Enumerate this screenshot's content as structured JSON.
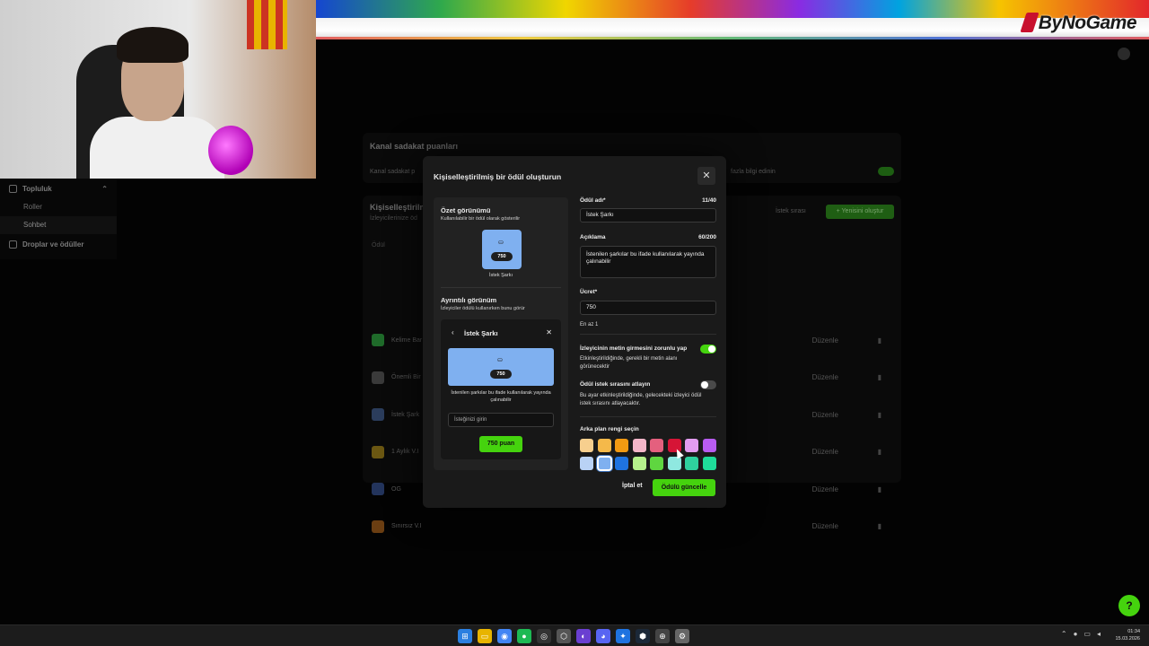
{
  "brand": {
    "logo_text": "ByNoGame"
  },
  "sidebar": {
    "group_label": "Topluluk",
    "items": [
      {
        "label": "Roller",
        "active": false
      },
      {
        "label": "Sohbet",
        "active": true
      }
    ],
    "group2_label": "Droplar ve ödüller"
  },
  "background": {
    "loyalty_title": "Kanal sadakat puanları",
    "loyalty_sub": "Kanal sadakat p",
    "loyalty_more": "fazla bilgi edinin",
    "custom_title": "Kişiselleştirilm",
    "custom_sub": "İzleyicilerinize öd",
    "queue_label": "İstek sırası",
    "new_button": "+ Yenisini oluştur",
    "col_reward": "Ödül",
    "edit_label": "Düzenle",
    "rows": [
      {
        "name": "Kelime Bar",
        "color": "#1f6b2a"
      },
      {
        "name": "Önemli Bir",
        "color": "#3a3a3a"
      },
      {
        "name": "İstek Şark",
        "color": "#2b3d5c"
      },
      {
        "name": "1 Aylık V.I",
        "color": "#6b5712"
      },
      {
        "name": "OG",
        "color": "#23345c"
      },
      {
        "name": "Sınırsız V.I",
        "color": "#6b3e12"
      }
    ]
  },
  "modal": {
    "title": "Kişiselleştirilmiş bir ödül oluşturun",
    "preview": {
      "summary_title": "Özet görünümü",
      "summary_sub": "Kullanılabilir bir ödül olarak gösterilir",
      "reward_cost": "750",
      "reward_name": "İstek Şarkı",
      "detail_title": "Ayrıntılı görünüm",
      "detail_sub": "İzleyiciler ödülü kullanırken bunu görür",
      "detail_header": "İstek Şarkı",
      "detail_desc": "İstenilen şarkılar bu ifade kullanılarak yayında çalınabilir",
      "input_placeholder": "İsteğinizi girin",
      "redeem_button": "750 puan"
    },
    "form": {
      "name_label": "Ödül adı*",
      "name_count": "11/40",
      "name_value": "İstek Şarkı",
      "desc_label": "Açıklama",
      "desc_count": "60/200",
      "desc_value": "İstenilen şarkılar bu ifade kullanılarak yayında çalınabilir",
      "cost_label": "Ücret*",
      "cost_value": "750",
      "cost_hint": "En az 1",
      "require_text_label": "İzleyicinin metin girmesini zorunlu yap",
      "require_text_desc": "Etkinleştirildiğinde, gerekli bir metin alanı görünecektir",
      "require_text_on": true,
      "skip_queue_label": "Ödül istek sırasını atlayın",
      "skip_queue_desc": "Bu ayar etkinleştirildiğinde, gelecekteki izleyici ödül istek sırasını atlayacaktır.",
      "skip_queue_on": false,
      "color_label": "Arka plan rengi seçin",
      "colors": [
        "#f7cf8e",
        "#f5b94a",
        "#f29a12",
        "#f4b6c9",
        "#e4607e",
        "#d61436",
        "#e39cf0",
        "#b85cf0",
        "#b9d2f5",
        "#7fb0f0",
        "#1f73e0",
        "#b6f28c",
        "#5fd640",
        "#8fe8e0",
        "#2fd19e",
        "#1fdc9a"
      ],
      "selected_color_index": 9
    },
    "cancel_button": "İptal et",
    "save_button": "Ödülü güncelle"
  },
  "taskbar": {
    "apps": [
      "start",
      "explorer",
      "chrome",
      "spotify",
      "obs",
      "epic",
      "app-purple",
      "discord",
      "app-blue",
      "steam",
      "app-cursor",
      "settings"
    ],
    "time": "01:34",
    "date": "15.03.2026"
  }
}
